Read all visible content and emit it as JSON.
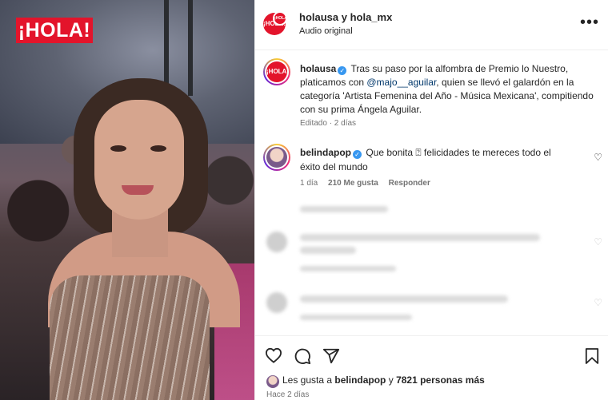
{
  "media": {
    "logo_text": "¡HOLA!"
  },
  "header": {
    "accounts": "holausa y hola_mx",
    "audio": "Audio original",
    "more_label": "•••"
  },
  "caption": {
    "username": "holausa",
    "text_1": "Tras su paso por la alfombra de Premio lo Nuestro, platicamos con ",
    "mention": "@majo__aguilar",
    "text_2": ", quien se llevó el galardón en la categoría 'Artista Femenina del Año - Música Mexicana', compitiendo con su prima Ángela Aguilar.",
    "meta": "Editado · 2 días"
  },
  "comment": {
    "username": "belindapop",
    "text": "Que bonita ⍰ felicidades te mereces todo el éxito del mundo",
    "time": "1 día",
    "likes": "210 Me gusta",
    "reply": "Responder"
  },
  "footer": {
    "likes_prefix": "Les gusta a ",
    "likes_user": "belindapop",
    "likes_mid": " y ",
    "likes_count": "7821 personas más",
    "time": "Hace 2 días"
  },
  "avatar_label": "¡HOLA!",
  "colors": {
    "brand": "#e3142b",
    "verified": "#3797f0",
    "mention": "#00376b"
  }
}
